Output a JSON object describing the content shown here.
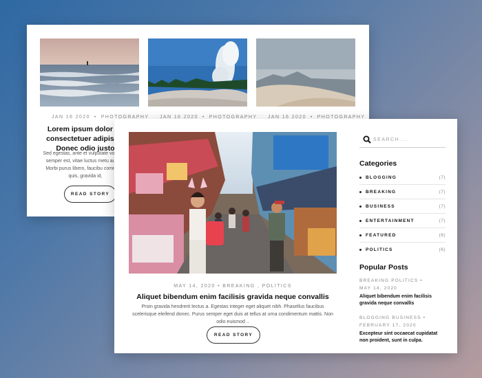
{
  "back_card": {
    "posts": [
      {
        "date": "JAN 16 2020",
        "category": "PHOTOGRAPHY",
        "image": "ocean-surfer-photo"
      },
      {
        "date": "JAN 16 2020",
        "category": "PHOTOGRAPHY",
        "image": "geyser-photo"
      },
      {
        "date": "JAN 16 2020",
        "category": "PHOTOGRAPHY",
        "image": "desert-dunes-photo"
      }
    ],
    "title": "Lorem ipsum dolor sit consectetuer adipiscin Donec odio justo",
    "excerpt": "Sed egestas, ante et vulputate vol pede semper est, vitae luctus metu augue. Morbi purus libero, faucibu commodo quis, gravida id,",
    "read_story": "READ STORY"
  },
  "front_card": {
    "image": "street-market-photo",
    "meta": "MAY 14, 2020  •  BREAKING , POLITICS",
    "title": "Aliquet bibendum enim facilisis gravida neque convallis",
    "excerpt": "Proin gravida hendrerit lectus a. Egestas integer eget aliquet nibh. Phasellus faucibus scelerisque eleifend donec. Purus semper eget duis at tellus at urna condimentum mattis. Non odio euismod ..",
    "read_story": "READ STORY"
  },
  "sidebar": {
    "search_placeholder": "SEARCH....",
    "categories_heading": "Categories",
    "categories": [
      {
        "name": "BLOGGING",
        "count": "(7)"
      },
      {
        "name": "BREAKING",
        "count": "(7)"
      },
      {
        "name": "BUSINESS",
        "count": "(7)"
      },
      {
        "name": "ENTERTAINMENT",
        "count": "(7)"
      },
      {
        "name": "FEATURED",
        "count": "(8)"
      },
      {
        "name": "POLITICS",
        "count": "(6)"
      }
    ],
    "popular_heading": "Popular Posts",
    "popular_posts": [
      {
        "tags": "BREAKING  POLITICS  •",
        "date": "MAY 14, 2020",
        "title": "Aliquet bibendum enim facilisis gravida neque convallis"
      },
      {
        "tags": "BLOGGING  BUSINESS  •",
        "date": "FEBRUARY 17, 2020",
        "title": "Excepteur sint occaecat cupidatat non proident, sunt in culpa."
      }
    ]
  },
  "colors": {
    "background_start": "#2f69a3",
    "background_end": "#b69c9e",
    "text": "#111111",
    "muted": "#888888"
  }
}
